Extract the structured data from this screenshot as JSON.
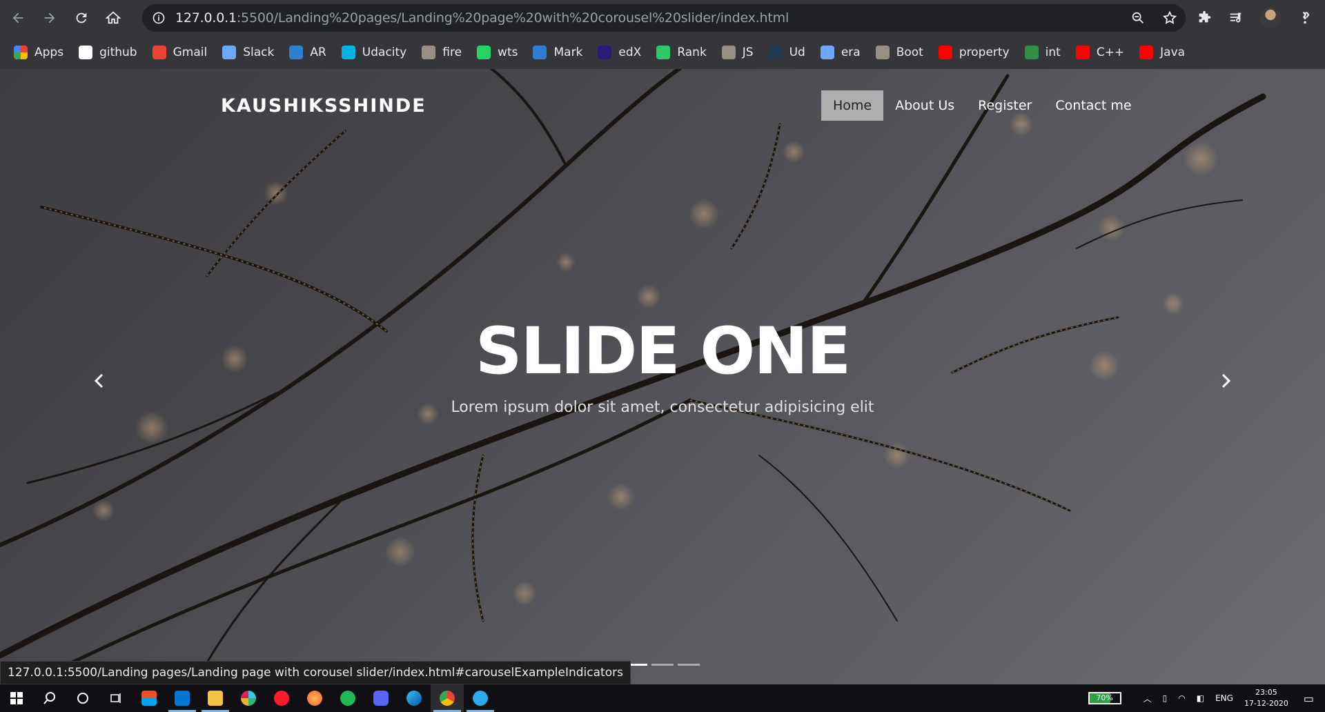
{
  "browser": {
    "url_host": "127.0.0.1",
    "url_rest": ":5500/Landing%20pages/Landing%20page%20with%20corousel%20slider/index.html",
    "status_link": "127.0.0.1:5500/Landing pages/Landing page with corousel slider/index.html#carouselExampleIndicators"
  },
  "bookmarks": [
    {
      "label": "Apps",
      "icon": "apps-grid-icon",
      "color": "#e8eaed"
    },
    {
      "label": "github",
      "icon": "github-icon",
      "color": "#ffffff"
    },
    {
      "label": "Gmail",
      "icon": "gmail-icon",
      "color": "#ea4335"
    },
    {
      "label": "Slack",
      "icon": "infinity-icon",
      "color": "#6ea6ff"
    },
    {
      "label": "AR",
      "icon": "shield-icon",
      "color": "#2f7fd0"
    },
    {
      "label": "Udacity",
      "icon": "udacity-icon",
      "color": "#02b3e4"
    },
    {
      "label": "fire",
      "icon": "avatar-icon",
      "color": "#9a8f84"
    },
    {
      "label": "wts",
      "icon": "whatsapp-icon",
      "color": "#25d366"
    },
    {
      "label": "Mark",
      "icon": "shield-icon",
      "color": "#2f7fd0"
    },
    {
      "label": "edX",
      "icon": "p-icon",
      "color": "#2b1a7a"
    },
    {
      "label": "Rank",
      "icon": "hackerrank-icon",
      "color": "#2ec866"
    },
    {
      "label": "JS",
      "icon": "avatar-icon",
      "color": "#9a8f84"
    },
    {
      "label": "Ud",
      "icon": "dark-r-icon",
      "color": "#1f3a4a"
    },
    {
      "label": "era",
      "icon": "infinity-icon",
      "color": "#6ea6ff"
    },
    {
      "label": "Boot",
      "icon": "avatar-icon",
      "color": "#9a8f84"
    },
    {
      "label": "property",
      "icon": "youtube-icon",
      "color": "#ff0000"
    },
    {
      "label": "int",
      "icon": "gfg-icon",
      "color": "#2f8d46"
    },
    {
      "label": "C++",
      "icon": "youtube-icon",
      "color": "#ff0000"
    },
    {
      "label": "Java",
      "icon": "youtube-icon",
      "color": "#ff0000"
    }
  ],
  "site": {
    "brand": "KAUSHIKSSHINDE",
    "menu": [
      "Home",
      "About Us",
      "Register",
      "Contact me"
    ],
    "active_menu": "Home"
  },
  "carousel": {
    "title": "SLIDE ONE",
    "subtitle": "Lorem ipsum dolor sit amet, consectetur adipisicing elit",
    "slide_count": 3,
    "active_index": 0
  },
  "taskbar": {
    "battery": "70%",
    "battery_level": 0.7,
    "language": "ENG",
    "time": "23:05",
    "date": "17-12-2020"
  }
}
